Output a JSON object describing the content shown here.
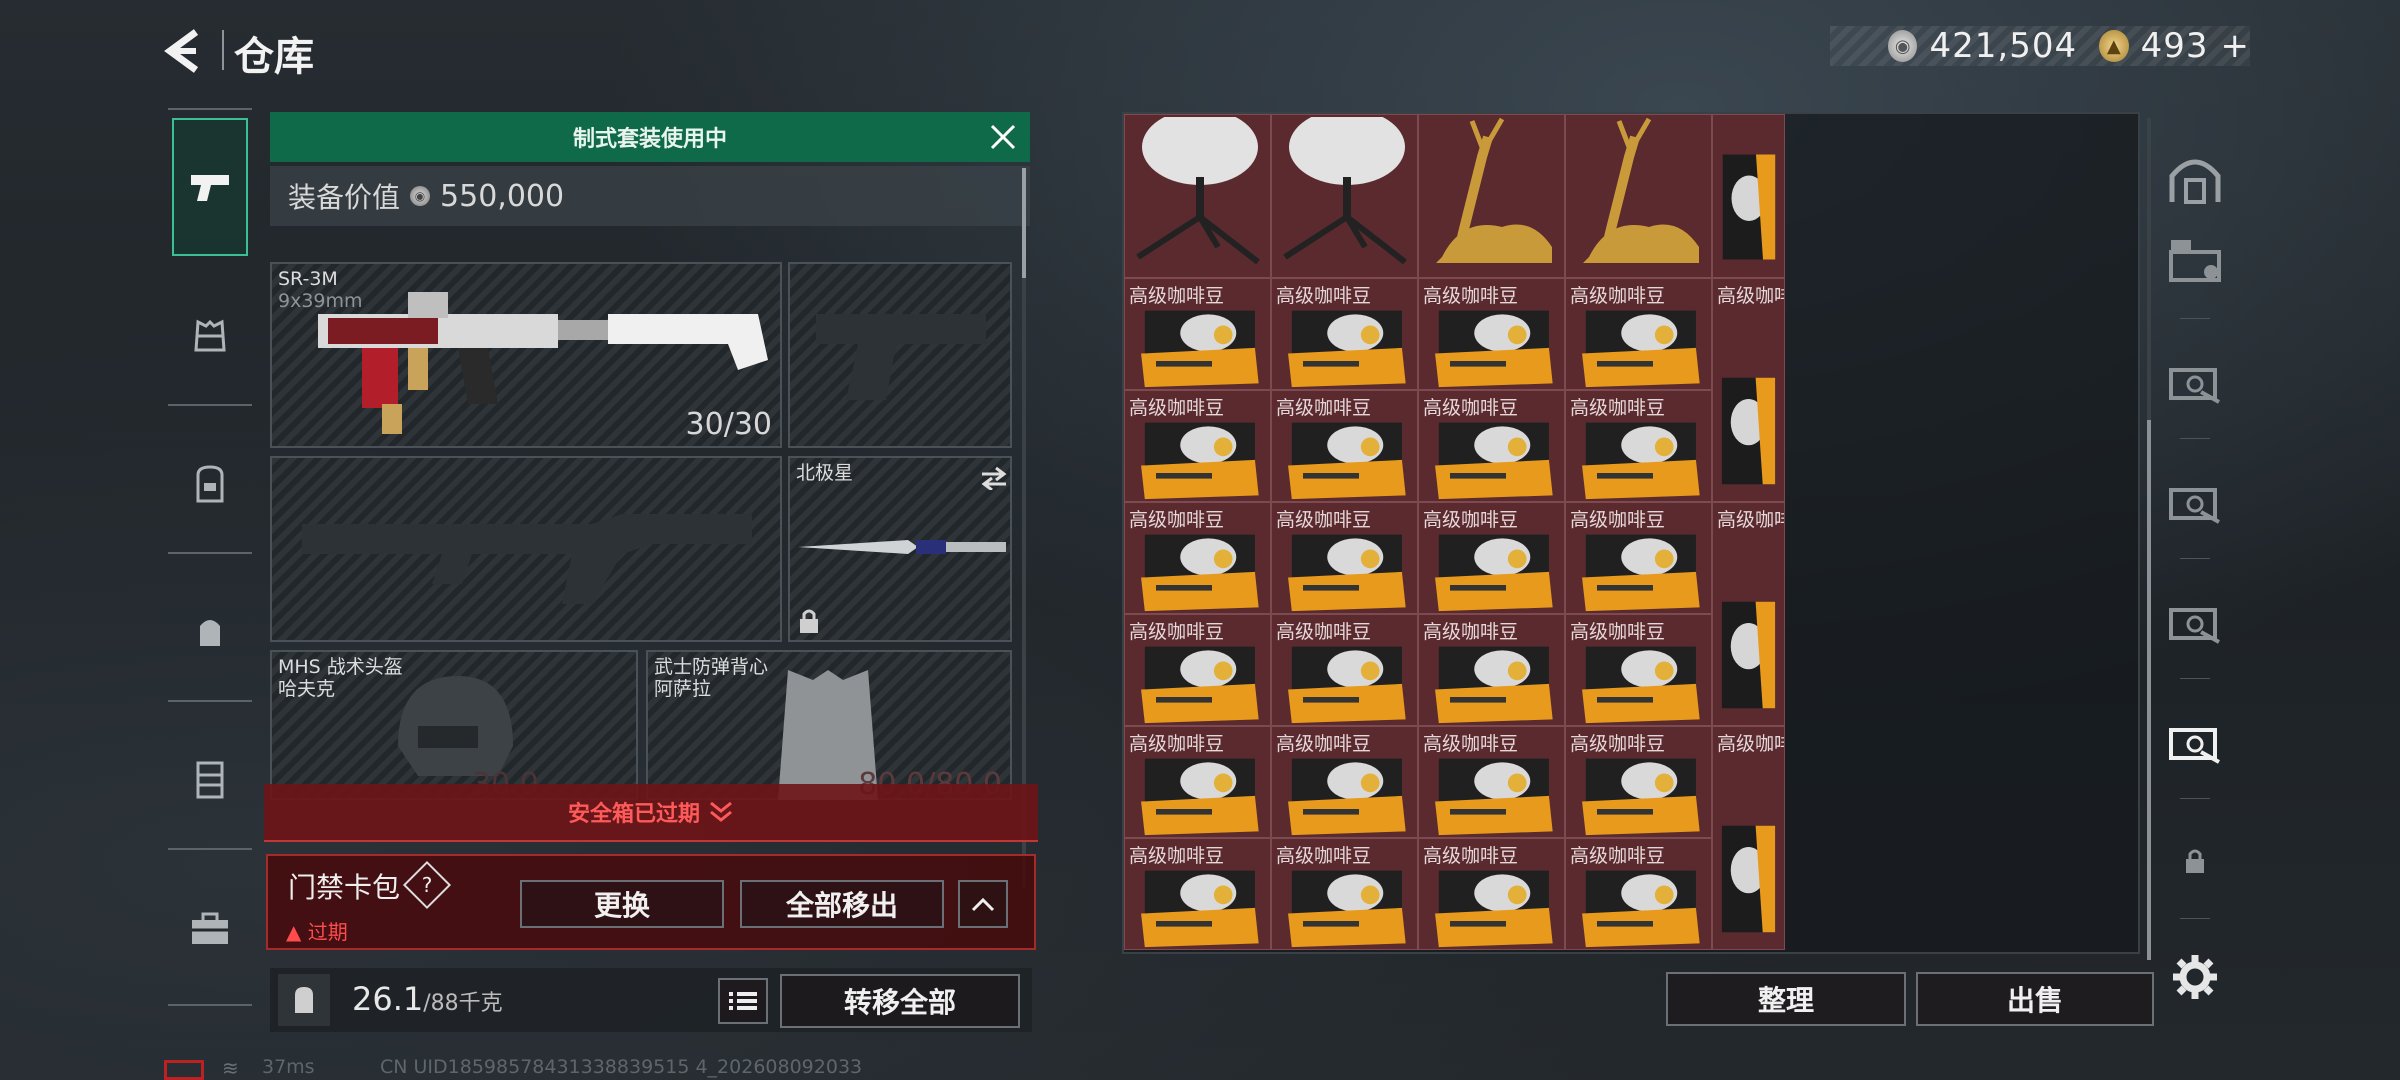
{
  "header": {
    "title": "仓库",
    "silver_amount": "421,504",
    "gold_amount": "493",
    "gold_plus": "+"
  },
  "tabs": [
    "weapon-icon",
    "armor-icon",
    "backpack-icon",
    "pouch-icon",
    "vest-icon",
    "case-icon"
  ],
  "equipment": {
    "kit_banner": "制式套装使用中",
    "value_label": "装备价值",
    "value": "550,000",
    "primary": {
      "name": "SR-3M",
      "caliber": "9x39mm",
      "ammo": "30/30"
    },
    "melee": {
      "name": "北极星"
    },
    "helmet": {
      "name": "MHS 战术头盔",
      "sub": "哈夫克",
      "durability": "30.0"
    },
    "vest": {
      "name": "武士防弹背心",
      "sub": "阿萨拉",
      "durability": "80.0/80.0"
    },
    "safe_box_text": "安全箱已过期",
    "card_pack": {
      "title": "门禁卡包",
      "help": "?",
      "status": "过期",
      "replace": "更换",
      "move_all": "全部移出"
    },
    "weight": "26.1",
    "weight_max": "/88千克",
    "transfer_all": "转移全部"
  },
  "grid": {
    "coffee_label": "高级咖啡豆"
  },
  "actions": {
    "sort": "整理",
    "sell": "出售"
  },
  "status": {
    "ping": "37ms",
    "uid": "CN UID18598578431338839515 4_202608092033"
  }
}
